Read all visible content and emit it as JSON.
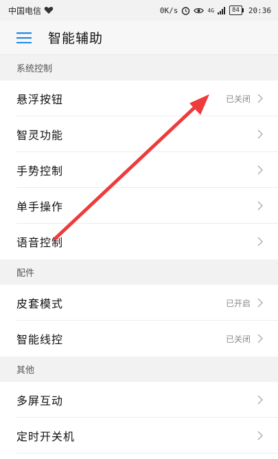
{
  "status_bar": {
    "carrier": "中国电信",
    "speed": "0K/s",
    "network": "4G",
    "battery": "84",
    "time": "20:36"
  },
  "header": {
    "title": "智能辅助"
  },
  "sections": [
    {
      "title": "系统控制",
      "items": [
        {
          "label": "悬浮按钮",
          "status": "已关闭"
        },
        {
          "label": "智灵功能",
          "status": ""
        },
        {
          "label": "手势控制",
          "status": ""
        },
        {
          "label": "单手操作",
          "status": ""
        },
        {
          "label": "语音控制",
          "status": ""
        }
      ]
    },
    {
      "title": "配件",
      "items": [
        {
          "label": "皮套模式",
          "status": "已开启"
        },
        {
          "label": "智能线控",
          "status": "已关闭"
        }
      ]
    },
    {
      "title": "其他",
      "items": [
        {
          "label": "多屏互动",
          "status": ""
        },
        {
          "label": "定时开关机",
          "status": ""
        }
      ]
    }
  ],
  "colors": {
    "accent": "#1e88e5",
    "annotation_arrow": "#ee3b3b",
    "section_bg": "#f2f2f2"
  }
}
